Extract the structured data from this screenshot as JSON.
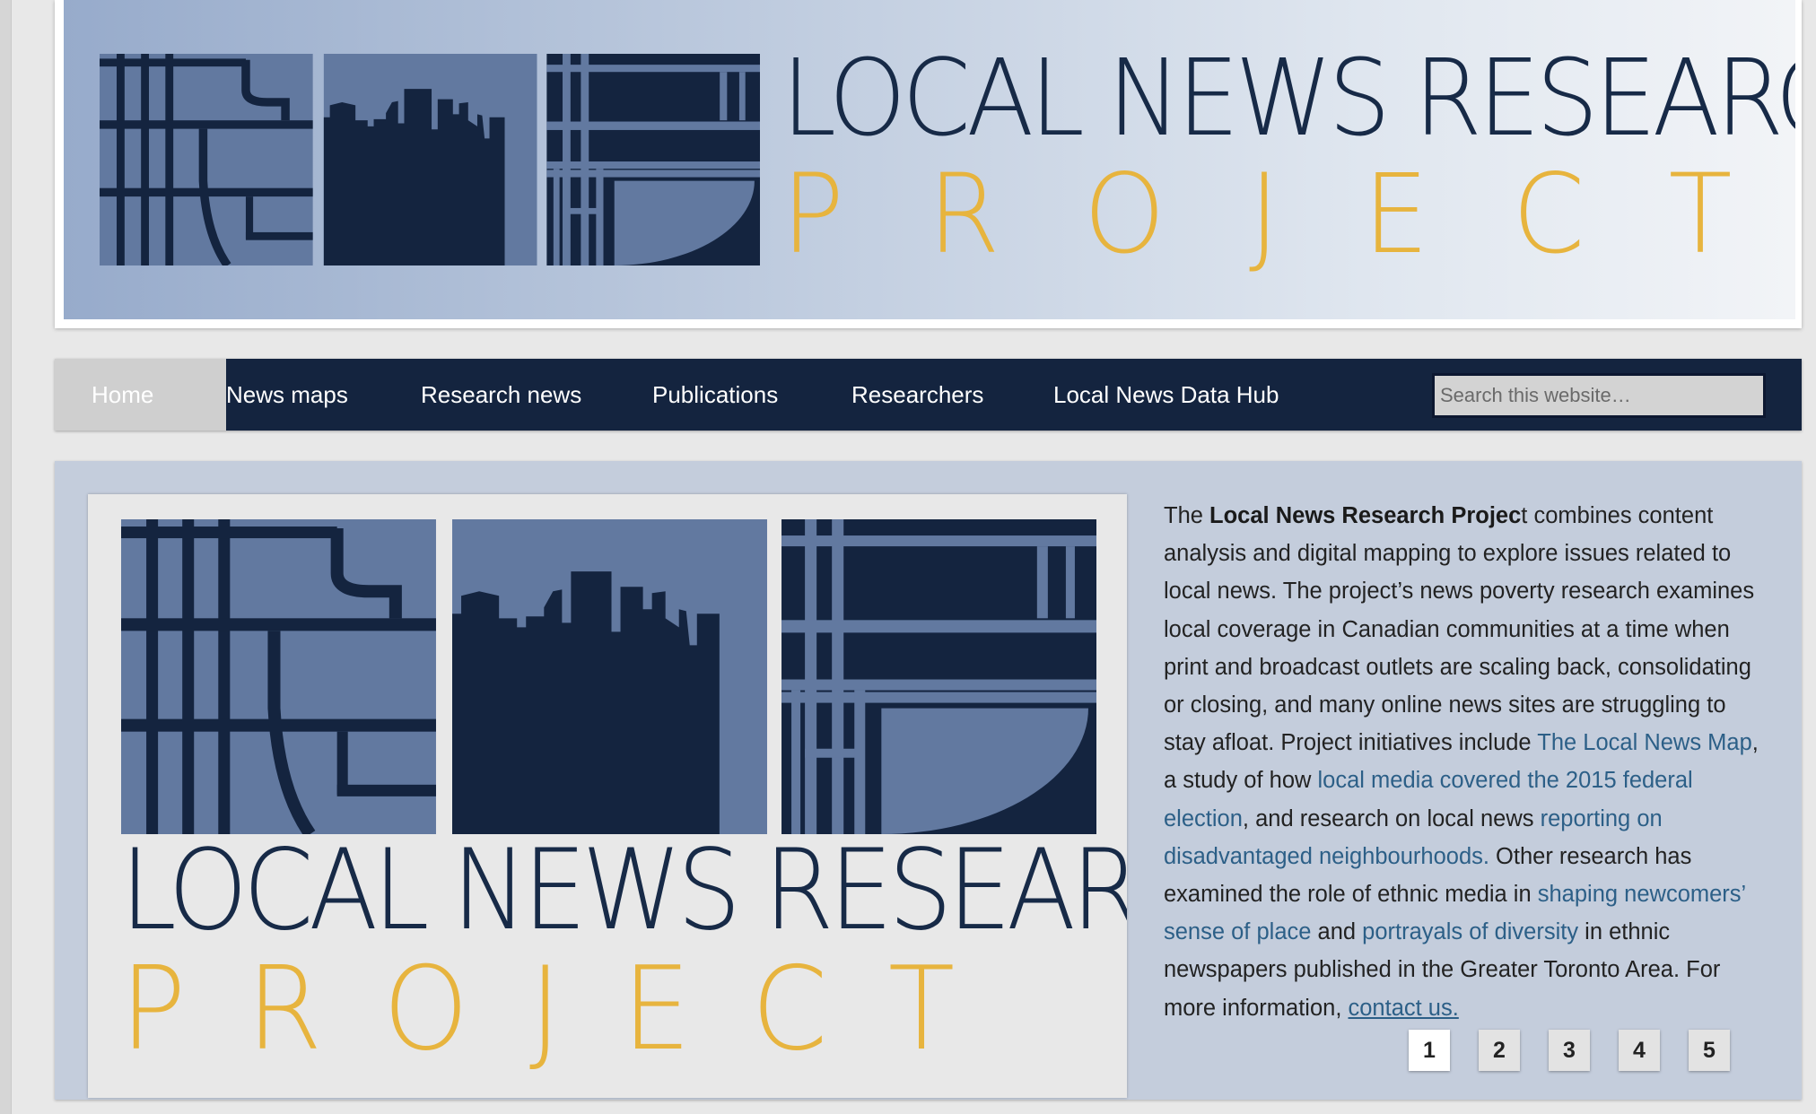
{
  "banner": {
    "wordmark_line1": "LOCAL NEWS RESEARCH",
    "wordmark_line2": "PROJECT",
    "logo_icon": "city-grid-skyline-logo"
  },
  "nav": {
    "items": [
      {
        "label": "Home",
        "active": true
      },
      {
        "label": "News maps"
      },
      {
        "label": "Research news"
      },
      {
        "label": "Publications"
      },
      {
        "label": "Researchers"
      },
      {
        "label": "Local News Data Hub"
      }
    ],
    "search_placeholder": "Search this website…"
  },
  "slide": {
    "wordmark_line1": "LOCAL NEWS RESEARCH",
    "wordmark_line2": "PROJECT"
  },
  "description": {
    "t1": "The ",
    "t2": "Local News Research Projec",
    "t3": "t combines content analysis and digital mapping to explore issues related to local news. The project’s news poverty research examines local coverage in Canadian communities at a time when print and broadcast outlets are scaling back, consolidating or closing, and many online news sites are struggling to stay afloat. Project initiatives include ",
    "link_news_map": "The Local News Map",
    "t4": ", a study of how ",
    "link_election": "local media covered the 2015 federal election",
    "t5": ", and research on local news ",
    "link_neighbourhoods": "reporting on disadvantaged neighbourhoods.",
    "t6": " Other research has examined the role of ethnic media in ",
    "link_newcomers": "shaping newcomers’ sense of place",
    "t7": " and ",
    "link_diversity": "portrayals of diversity",
    "t8": " in ethnic newspapers published in the Greater Toronto Area. For more information, ",
    "link_contact": "contact us."
  },
  "pager": {
    "pages": [
      "1",
      "2",
      "3",
      "4",
      "5"
    ],
    "current": "1"
  },
  "colors": {
    "navy": "#14243f",
    "gold": "#e7b43e",
    "slate": "#6279a0",
    "link": "#2c5f87"
  }
}
